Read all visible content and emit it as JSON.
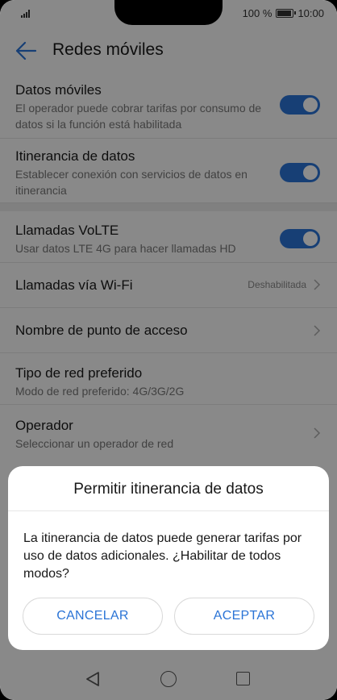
{
  "status": {
    "battery_text": "100 %",
    "time": "10:00",
    "battery_level": 1.0
  },
  "header": {
    "title": "Redes móviles"
  },
  "settings": {
    "datos_moviles": {
      "title": "Datos móviles",
      "subtitle": "El operador puede cobrar tarifas por consumo de datos si la función está habilitada",
      "enabled": true
    },
    "itinerancia": {
      "title": "Itinerancia de datos",
      "subtitle": "Establecer conexión con servicios de datos en itinerancia",
      "enabled": true
    },
    "volte": {
      "title": "Llamadas VoLTE",
      "subtitle": "Usar datos LTE 4G para hacer llamadas HD",
      "enabled": true
    },
    "wifi_calls": {
      "title": "Llamadas vía Wi-Fi",
      "value": "Deshabilitada"
    },
    "apn": {
      "title": "Nombre de punto de acceso"
    },
    "red_preferida": {
      "title": "Tipo de red preferido",
      "subtitle": "Modo de red preferido: 4G/3G/2G"
    },
    "operador": {
      "title": "Operador",
      "subtitle": "Seleccionar un operador de red"
    }
  },
  "dialog": {
    "title": "Permitir itinerancia de datos",
    "body": "La itinerancia de datos puede generar tarifas por uso de datos adicionales. ¿Habilitar de todos modos?",
    "cancel_label": "CANCELAR",
    "accept_label": "ACEPTAR"
  },
  "colors": {
    "accent": "#2b74d6",
    "background": "#fafafa",
    "text": "#191919",
    "secondary_text": "#777777"
  },
  "icons": [
    "signal-icon",
    "battery-icon",
    "back-arrow-icon",
    "chevron-right-icon",
    "nav-back-icon",
    "nav-home-icon",
    "nav-recents-icon"
  ]
}
